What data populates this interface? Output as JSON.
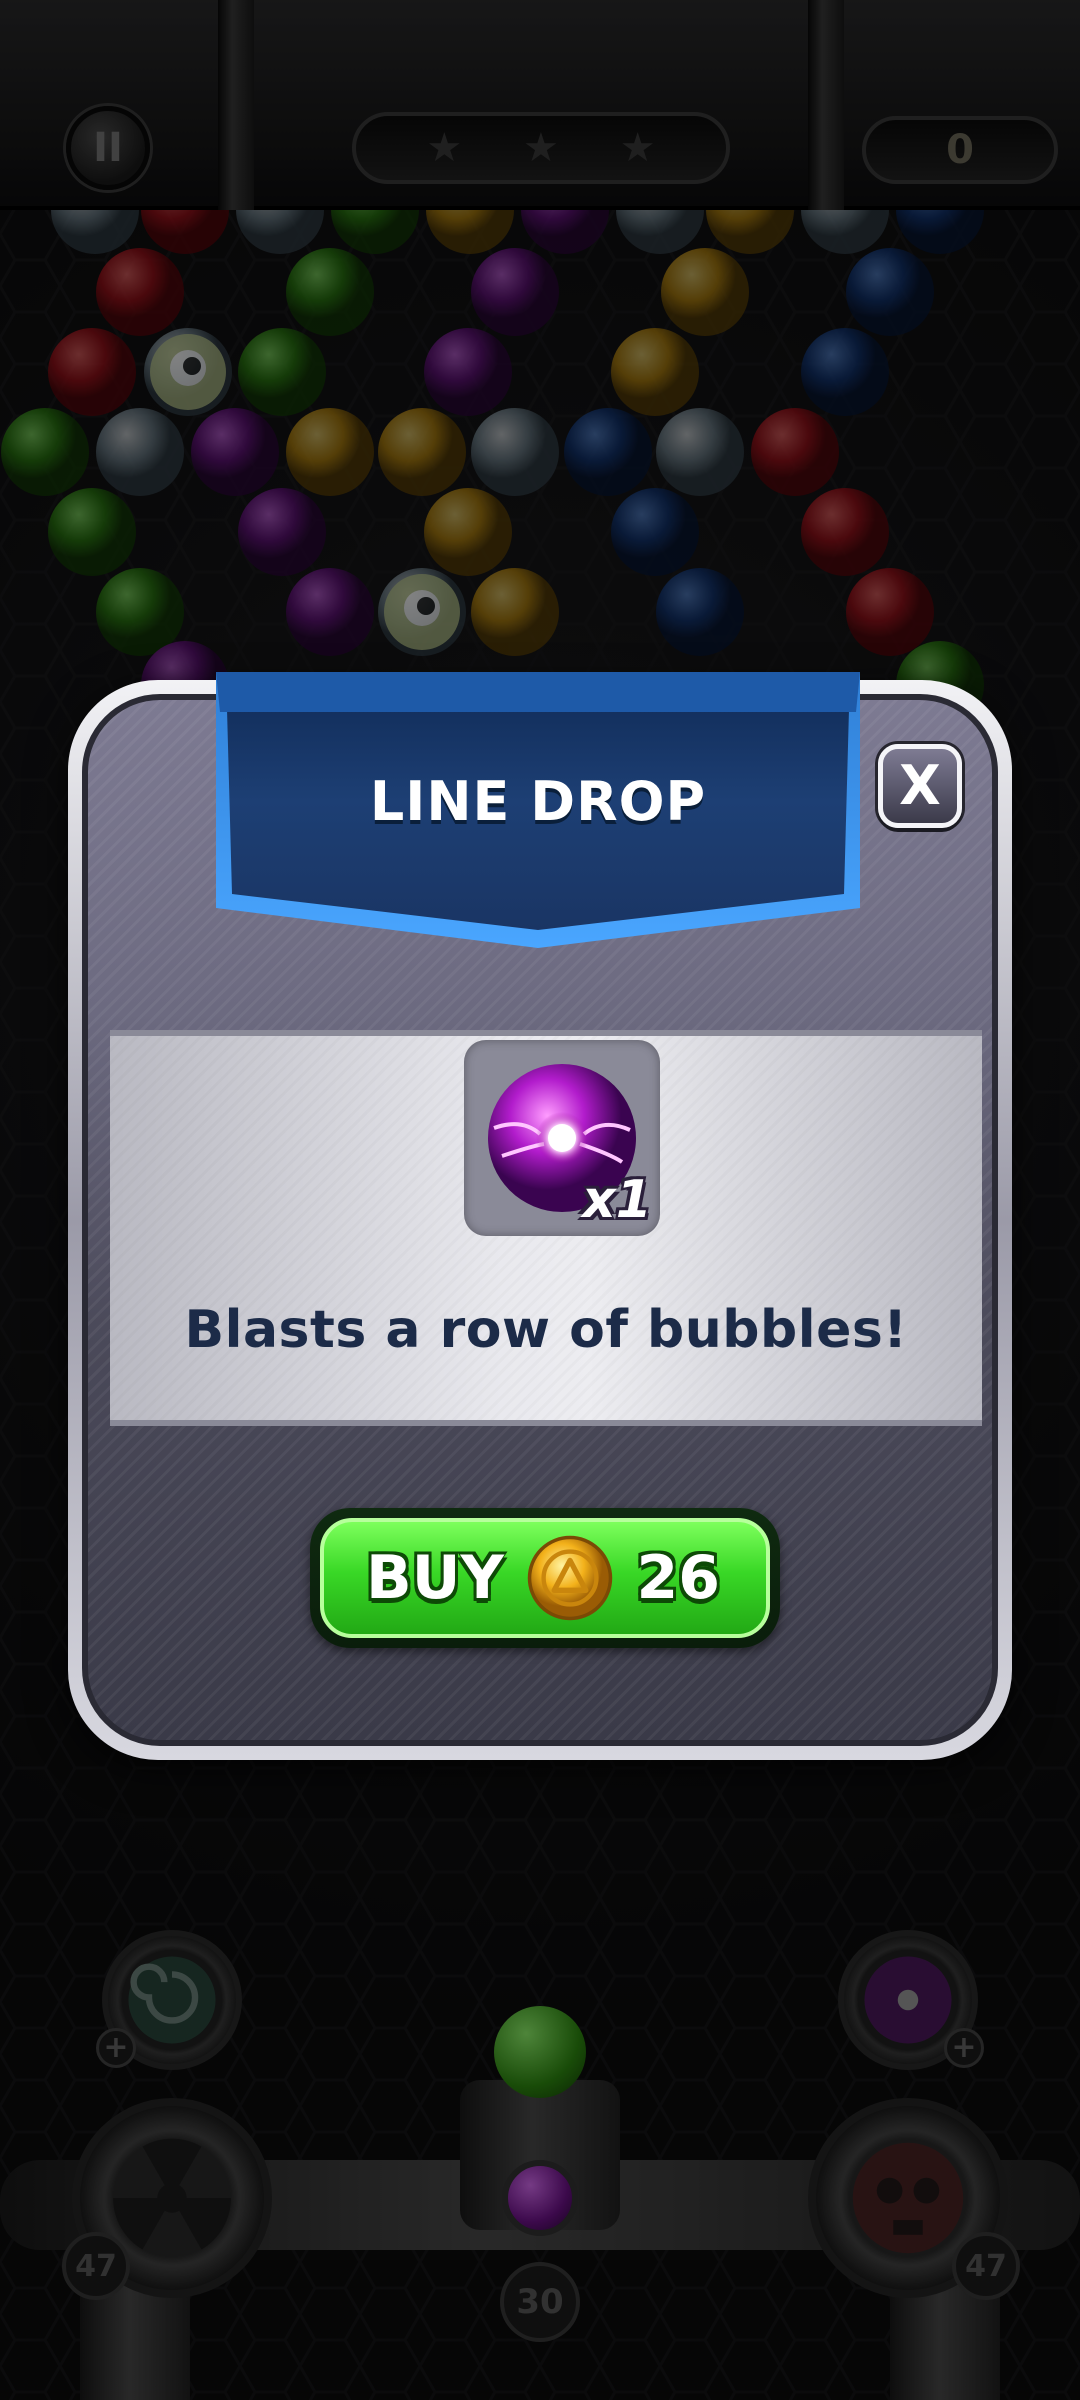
{
  "hud": {
    "pause_label": "II",
    "stars": [
      "★",
      "★",
      "★"
    ],
    "score": "0"
  },
  "modal": {
    "title": "LINE DROP",
    "close_label": "X",
    "item": {
      "icon": "line-drop-booster-icon",
      "quantity": "x1"
    },
    "description": "Blasts a row of bubbles!",
    "buy": {
      "label": "BUY",
      "currency_icon": "coin-icon",
      "price": "26"
    }
  },
  "bottom": {
    "left_counter": "47",
    "right_counter": "47",
    "shots_left": "30",
    "current_bubble_color": "#3a9a18",
    "next_bubble_color": "#6a1a8a"
  },
  "colors": {
    "ribbon_blue": "#1b4b8a",
    "buy_green": "#39d826",
    "title_text": "#1c2b48"
  }
}
